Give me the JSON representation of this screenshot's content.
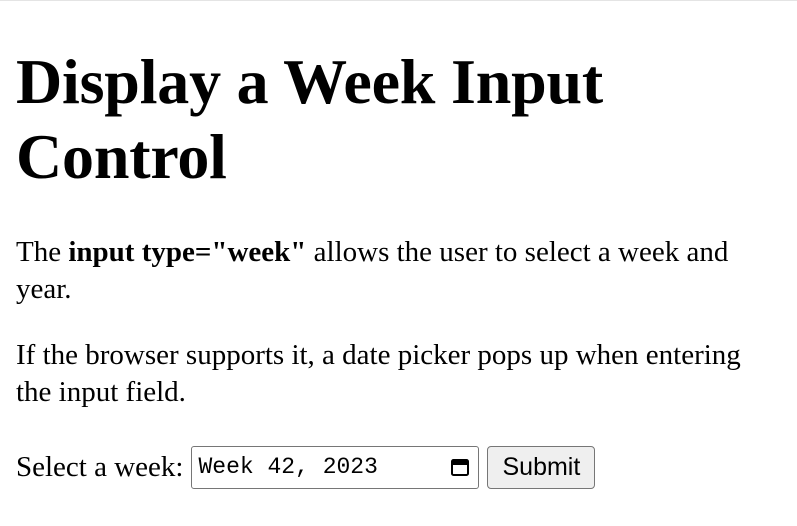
{
  "page": {
    "title": "Display a Week Input Control",
    "intro": {
      "before": "The ",
      "code": "input type=\"week\"",
      "after": " allows the user to select a week and year."
    },
    "note": "If the browser supports it, a date picker pops up when entering the input field.",
    "form": {
      "label": "Select a week:",
      "week_value": "Week 42, 2023",
      "picker_icon": "calendar-icon",
      "submit_label": "Submit"
    }
  }
}
